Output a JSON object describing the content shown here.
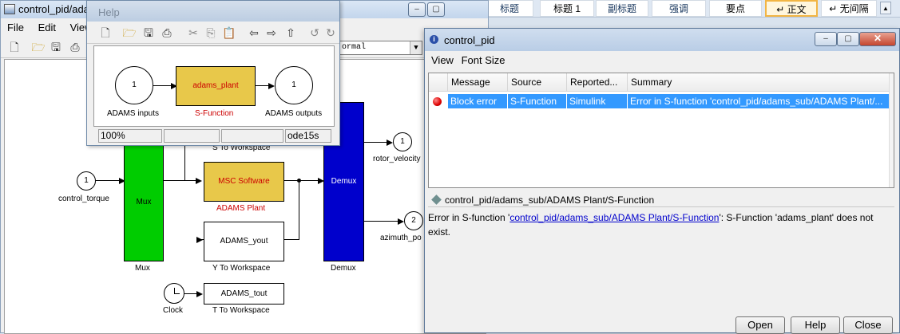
{
  "main_window": {
    "title": "control_pid/ada",
    "menu": [
      "File",
      "Edit",
      "View"
    ],
    "style_select": "ormal"
  },
  "ribbon": {
    "styles": [
      "标题",
      "标题 1",
      "副标题",
      "强调",
      "要点",
      "↵ 正文",
      "↵ 无间隔"
    ]
  },
  "subsystem_window": {
    "title": "Help",
    "blocks": {
      "in_port": {
        "num": "1",
        "label": "ADAMS inputs"
      },
      "sfunction": {
        "text": "adams_plant",
        "label": "S-Function"
      },
      "out_port": {
        "num": "1",
        "label": "ADAMS outputs"
      }
    },
    "status": {
      "zoom": "100%",
      "cell1": "",
      "cell2": "",
      "solver": "ode15s"
    }
  },
  "model": {
    "clipped_label_top": "S To Workspace",
    "control_torque": {
      "num": "1",
      "label": "control_torque"
    },
    "mux": {
      "text": "Mux",
      "label": "Mux"
    },
    "msc_block": {
      "text": "MSC Software",
      "label": "ADAMS Plant"
    },
    "yout": {
      "text": "ADAMS_yout",
      "label": "Y To Workspace"
    },
    "demux": {
      "text": "Demux",
      "label": "Demux"
    },
    "rotor_velocity": {
      "num": "1",
      "label": "rotor_velocity"
    },
    "azimuth": {
      "num": "2",
      "label": "azimuth_po"
    },
    "clock": {
      "label": "Clock"
    },
    "tout": {
      "text": "ADAMS_tout",
      "label": "T To Workspace"
    }
  },
  "dialog": {
    "title": "control_pid",
    "menu": [
      "View",
      "Font Size"
    ],
    "columns": [
      "Message",
      "Source",
      "Reported...",
      "Summary"
    ],
    "row": {
      "message": "Block error",
      "source": "S-Function",
      "reported": "Simulink",
      "summary": "Error in S-function 'control_pid/adams_sub/ADAMS Plant/..."
    },
    "detail_header": "control_pid/adams_sub/ADAMS Plant/S-Function",
    "detail_prefix": "Error in S-function '",
    "detail_link": "control_pid/adams_sub/ADAMS Plant/S-Function",
    "detail_suffix": "': S-Function 'adams_plant' does not exist.",
    "buttons": {
      "open": "Open",
      "help": "Help",
      "close": "Close"
    }
  },
  "colors": {
    "mux": "#00cc00",
    "demux": "#0000cc",
    "sfunction_fill": "#e8c84a",
    "sfunction_text": "#cc0000",
    "selection": "#3399ff",
    "error_dot": "#dd0000"
  }
}
